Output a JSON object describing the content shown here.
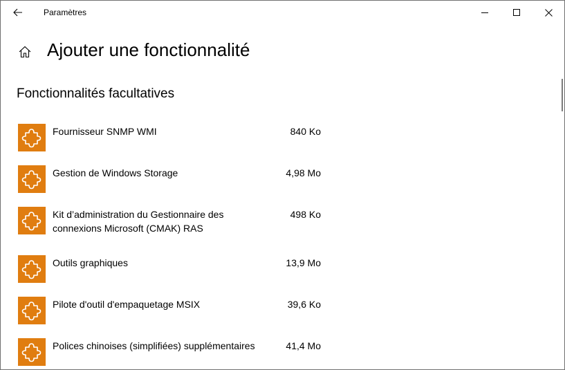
{
  "titlebar": {
    "title": "Paramètres",
    "back_icon": "back-arrow-icon",
    "minimize_icon": "minimize-icon",
    "maximize_icon": "maximize-icon",
    "close_icon": "close-icon"
  },
  "header": {
    "home_icon": "home-icon",
    "title": "Ajouter une fonctionnalité"
  },
  "section": {
    "title": "Fonctionnalités facultatives"
  },
  "colors": {
    "icon_background": "#e07d10",
    "icon_foreground": "#ffffff",
    "text": "#000000",
    "window_border": "#6f6f6f"
  },
  "features": [
    {
      "name": "Fournisseur SNMP WMI",
      "size": "840 Ko",
      "icon": "puzzle-piece-icon"
    },
    {
      "name": "Gestion de Windows Storage",
      "size": "4,98 Mo",
      "icon": "puzzle-piece-icon"
    },
    {
      "name": "Kit d’administration du Gestionnaire des connexions Microsoft (CMAK) RAS",
      "size": "498 Ko",
      "icon": "puzzle-piece-icon"
    },
    {
      "name": "Outils graphiques",
      "size": "13,9 Mo",
      "icon": "puzzle-piece-icon"
    },
    {
      "name": "Pilote d'outil d'empaquetage MSIX",
      "size": "39,6 Ko",
      "icon": "puzzle-piece-icon"
    },
    {
      "name": "Polices chinoises (simplifiées) supplémentaires",
      "size": "41,4 Mo",
      "icon": "puzzle-piece-icon"
    }
  ]
}
